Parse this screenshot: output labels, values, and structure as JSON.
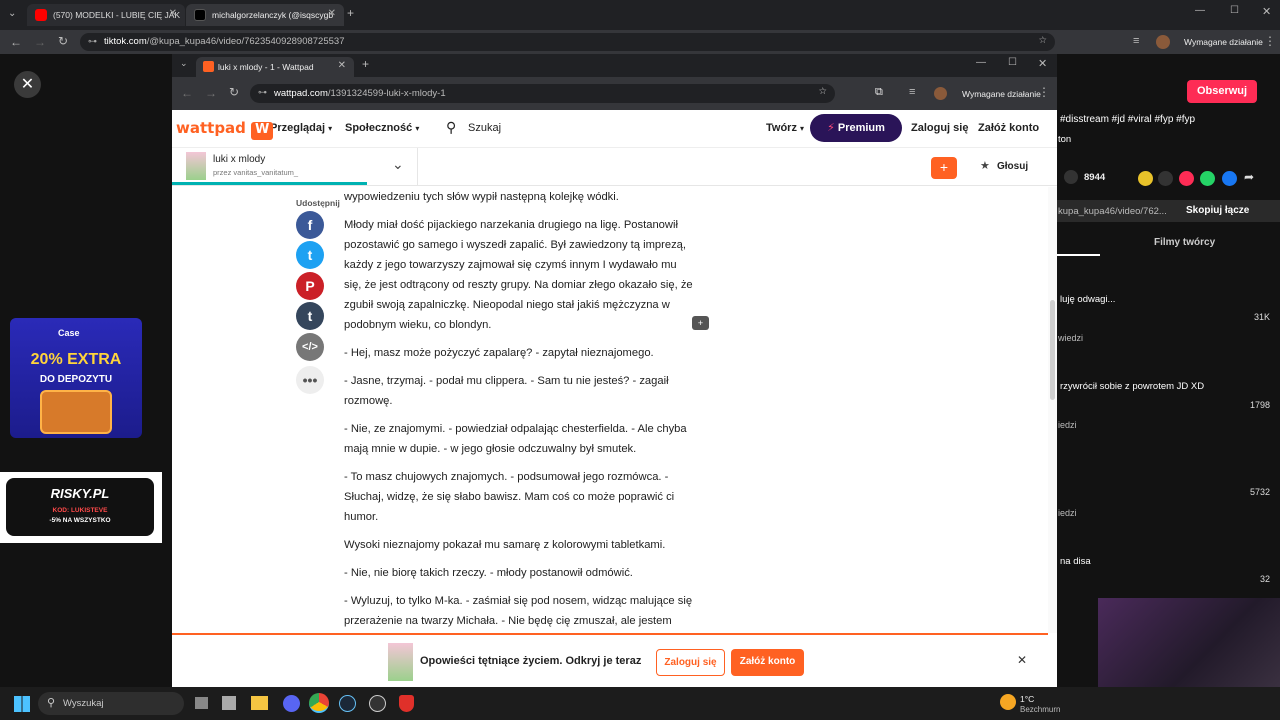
{
  "outer_tabs": [
    {
      "label": "(570) MODELKI - LUBIĘ CIĘ JAK",
      "active": false
    },
    {
      "label": "michalgorzelanczyk (@isqscygb",
      "active": true
    }
  ],
  "outer_url": {
    "host": "tiktok.com",
    "path": "/@kupa_kupa46/video/7623540928908725537"
  },
  "outer_action": "Wymagane działanie",
  "inner_tab": {
    "label": "luki x mlody - 1 - Wattpad"
  },
  "inner_url": {
    "host": "wattpad.com",
    "path": "/1391324599-luki-x-mlody-1"
  },
  "inner_action": "Wymagane działanie",
  "wattpad": {
    "logo": "wattpad",
    "nav": {
      "browse": "Przeglądaj",
      "community": "Społeczność",
      "search": "Szukaj",
      "write": "Twórz",
      "premium": "Premium",
      "login": "Zaloguj się",
      "signup": "Załóż konto"
    },
    "story": {
      "title": "luki x mlody",
      "author": "przez vanitas_vanitatum_",
      "vote": "Głosuj",
      "progress": 0.22
    },
    "share_label": "Udostępnij",
    "paragraphs": [
      "wypowiedzeniu tych słów wypił następną kolejkę wódki.",
      "Młody miał dość pijackiego narzekania drugiego na ligę. Postanowił pozostawić go samego i wyszedł zapalić. Był zawiedzony tą imprezą, każdy z jego towarzyszy zajmował się czymś innym I wydawało mu się, że jest odtrącony od reszty grupy. Na domiar złego okazało się, że zgubił swoją zapalniczkę. Nieopodal niego stał jakiś mężczyzna w podobnym wieku, co blondyn.",
      "- Hej, masz może pożyczyć zapalarę? - zapytał nieznajomego.",
      "- Jasne, trzymaj. - podał mu clippera. - Sam tu nie jesteś? - zagaił rozmowę.",
      "- Nie, ze znajomymi. - powiedział odpalając chesterfielda. - Ale chyba mają mnie w dupie. - w jego głosie odczuwalny był smutek.",
      "- To masz chujowych znajomych. - podsumował jego rozmówca. - Słuchaj, widzę, że się słabo bawisz. Mam coś co może poprawić ci humor.",
      "Wysoki nieznajomy pokazał mu samarę z kolorowymi tabletkami.",
      "- Nie, nie biorę takich rzeczy. - młody postanowił odmówić.",
      "- Wyluzuj, to tylko M-ka. - zaśmiał się pod nosem, widząc malujące się przerażenie na twarzy Michała. - Nie będę cię zmuszał, ale jestem"
    ],
    "banner": {
      "text": "Opowieści tętniące życiem. Odkryj je teraz",
      "login": "Zaloguj się",
      "signup": "Załóż konto"
    }
  },
  "tiktok": {
    "follow": "Obserwuj",
    "caption": "#disstream #jd #viral #fyp #fyp",
    "caption2": "ton",
    "saves": "8944",
    "link": "kupa_kupa46/video/762...",
    "copy_link": "Skopiuj łącze",
    "tab_creator": "Filmy twórcy",
    "items": [
      {
        "title": "luję odwagi...",
        "likes": "31K",
        "more": "wiedzi"
      },
      {
        "title": "rzywrócił sobie z powrotem JD XD",
        "likes": "1798",
        "more": "iedzi"
      },
      {
        "title": "",
        "likes": "5732",
        "more": "iedzi"
      },
      {
        "title": "na disa",
        "likes": "32",
        "more": ""
      }
    ]
  },
  "ads": {
    "case_brand": "Case",
    "case_promo": "20% EXTRA",
    "case_sub": "DO DEPOZYTU",
    "risky_brand": "RISKY.PL",
    "risky_code": "KOD: LUKISTEVE",
    "risky_sub": "-5% NA WSZYSTKO"
  },
  "taskbar": {
    "search": "Wyszukaj",
    "weather_temp": "1°C",
    "weather_desc": "Bezchmurn"
  }
}
